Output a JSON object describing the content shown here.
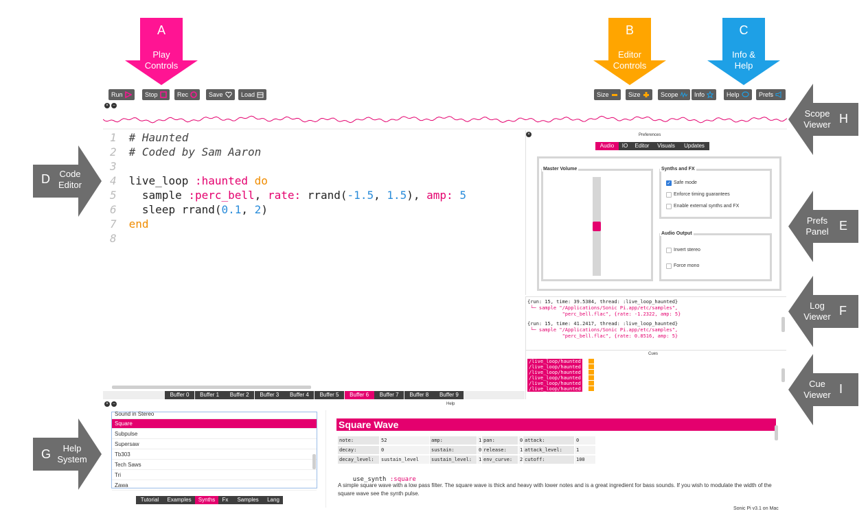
{
  "callouts": {
    "a": {
      "letter": "A",
      "label": "Play\nControls",
      "color": "#ff1493"
    },
    "b": {
      "letter": "B",
      "label": "Editor\nControls",
      "color": "#ffa500"
    },
    "c": {
      "letter": "C",
      "label": "Info &\nHelp",
      "color": "#1ea0e6"
    },
    "d": {
      "letter": "D",
      "label": "Code\nEditor",
      "color": "#6d6d6d"
    },
    "e": {
      "letter": "E",
      "label": "Prefs\nPanel",
      "color": "#6d6d6d"
    },
    "f": {
      "letter": "F",
      "label": "Log\nViewer",
      "color": "#6d6d6d"
    },
    "g": {
      "letter": "G",
      "label": "Help\nSystem",
      "color": "#6d6d6d"
    },
    "h": {
      "letter": "H",
      "label": "Scope\nViewer",
      "color": "#6d6d6d"
    },
    "i": {
      "letter": "I",
      "label": "Cue\nViewer",
      "color": "#6d6d6d"
    }
  },
  "toolbar": {
    "run": "Run",
    "stop": "Stop",
    "rec": "Rec",
    "save": "Save",
    "load": "Load",
    "size_minus": "Size",
    "size_plus": "Size",
    "scope": "Scope",
    "info": "Info",
    "help": "Help",
    "prefs": "Prefs"
  },
  "editor": {
    "lines": [
      {
        "n": "1",
        "parts": [
          {
            "t": "# Haunted",
            "c": "cm"
          }
        ]
      },
      {
        "n": "2",
        "parts": [
          {
            "t": "# Coded by Sam Aaron",
            "c": "cm"
          }
        ]
      },
      {
        "n": "3",
        "parts": []
      },
      {
        "n": "4",
        "parts": [
          {
            "t": "live_loop ",
            "c": ""
          },
          {
            "t": ":haunted",
            "c": "sym"
          },
          {
            "t": " do",
            "c": "kw"
          }
        ]
      },
      {
        "n": "5",
        "parts": [
          {
            "t": "  sample ",
            "c": ""
          },
          {
            "t": ":perc_bell",
            "c": "sym"
          },
          {
            "t": ", ",
            "c": ""
          },
          {
            "t": "rate:",
            "c": "sym"
          },
          {
            "t": " rrand(",
            "c": ""
          },
          {
            "t": "-1.5",
            "c": "num"
          },
          {
            "t": ", ",
            "c": ""
          },
          {
            "t": "1.5",
            "c": "num"
          },
          {
            "t": "), ",
            "c": ""
          },
          {
            "t": "amp:",
            "c": "sym"
          },
          {
            "t": " 5",
            "c": "num"
          }
        ]
      },
      {
        "n": "6",
        "parts": [
          {
            "t": "  sleep rrand(",
            "c": ""
          },
          {
            "t": "0.1",
            "c": "num"
          },
          {
            "t": ", ",
            "c": ""
          },
          {
            "t": "2",
            "c": "num"
          },
          {
            "t": ")",
            "c": ""
          }
        ]
      },
      {
        "n": "7",
        "parts": [
          {
            "t": "end",
            "c": "kw"
          }
        ]
      },
      {
        "n": "8",
        "parts": []
      }
    ]
  },
  "buffers": [
    "Buffer 0",
    "Buffer 1",
    "Buffer 2",
    "Buffer 3",
    "Buffer 4",
    "Buffer 5",
    "Buffer 6",
    "Buffer 7",
    "Buffer 8",
    "Buffer 9"
  ],
  "active_buffer": 6,
  "prefs": {
    "title": "Preferences",
    "tabs": [
      "Audio",
      "IO",
      "Editor",
      "Visuals",
      "Updates"
    ],
    "active_tab": 0,
    "master_volume": "Master Volume",
    "volume_level": 0.5,
    "synths_fx": "Synths and FX",
    "safe_mode": "Safe mode",
    "enforce_timing": "Enforce timing guarantees",
    "external_synths": "Enable external synths and FX",
    "audio_output": "Audio Output",
    "invert_stereo": "Invert stereo",
    "force_mono": "Force mono"
  },
  "log": {
    "entry1_head": "{run: 15, time: 39.5384, thread: :live_loop_haunted}",
    "entry1_body": " └─ sample \"/Applications/Sonic Pi.app/etc/samples\",\n            \"perc_bell.flac\", {rate: -1.2322, amp: 5}",
    "entry2_head": "{run: 15, time: 41.2417, thread: :live_loop_haunted}",
    "entry2_body": " └─ sample \"/Applications/Sonic Pi.app/etc/samples\",\n            \"perc_bell.flac\", {rate: 0.8516, amp: 5}"
  },
  "cues": {
    "title": "Cues",
    "items": [
      "/live_loop/haunted",
      "/live_loop/haunted",
      "/live_loop/haunted",
      "/live_loop/haunted",
      "/live_loop/haunted",
      "/live_loop/haunted"
    ]
  },
  "help": {
    "title": "Help",
    "list": [
      "Sound in Stereo",
      "Square",
      "Subpulse",
      "Supersaw",
      "Tb303",
      "Tech Saws",
      "Tri",
      "Zawa"
    ],
    "active_item": 1,
    "tabs": [
      "Tutorial",
      "Examples",
      "Synths",
      "Fx",
      "Samples",
      "Lang"
    ],
    "active_tab": 2,
    "heading": "Square Wave",
    "params": [
      [
        "note:",
        "52",
        "amp:",
        "1",
        "pan:",
        "0",
        "attack:",
        "0"
      ],
      [
        "decay:",
        "0",
        "sustain:",
        "0",
        "release:",
        "1",
        "attack_level:",
        "1"
      ],
      [
        "decay_level:",
        "sustain_level",
        "sustain_level:",
        "1",
        "env_curve:",
        "2",
        "cutoff:",
        "100"
      ]
    ],
    "use_synth_cmd": "use_synth",
    "use_synth_arg": ":square",
    "description": "A simple square wave with a low pass filter. The square wave is thick and heavy with lower notes and is a great ingredient for bass sounds. If you wish to modulate the width of the square wave see the synth pulse.",
    "version": "Sonic Pi v3.1 on Mac"
  }
}
